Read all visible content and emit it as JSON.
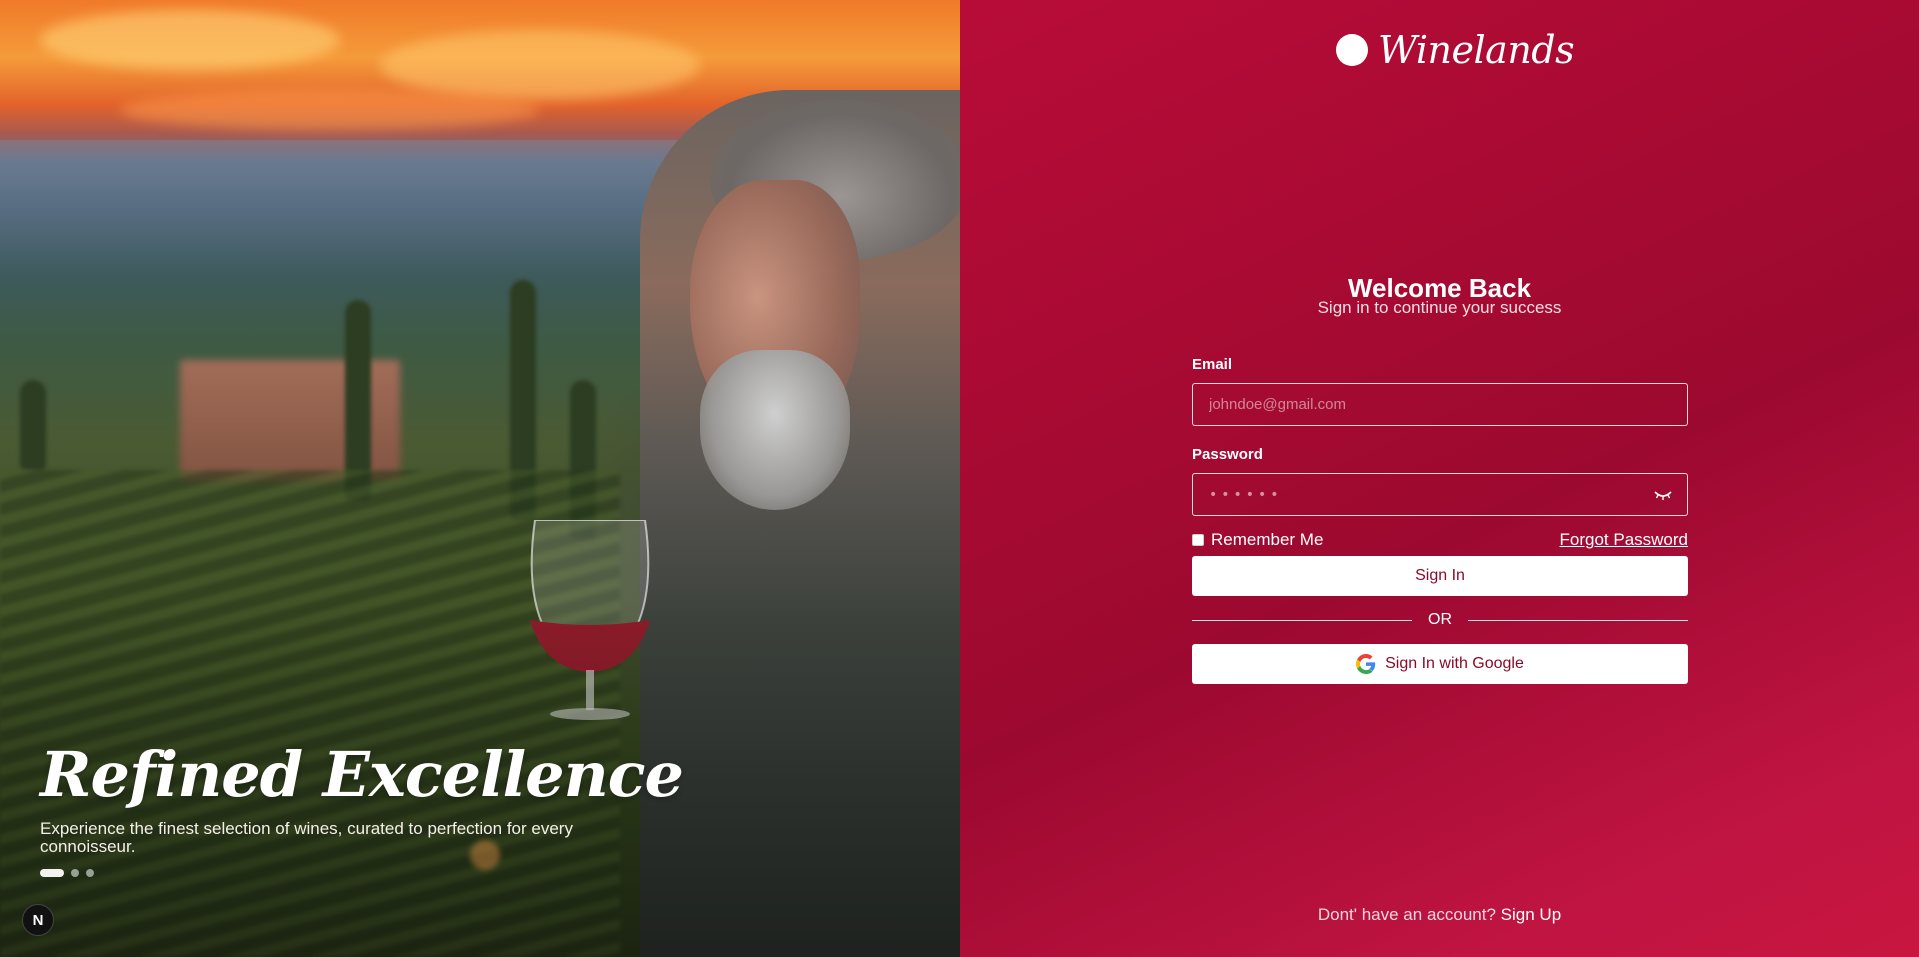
{
  "hero": {
    "title": "Refined Excellence",
    "subtitle": "Experience the finest selection of wines, curated to perfection for every connoisseur.",
    "carousel": {
      "slides": 3,
      "active_index": 0
    },
    "badge": "N"
  },
  "brand": {
    "name": "Winelands"
  },
  "auth": {
    "title": "Welcome Back",
    "subtitle": "Sign in to continue your success",
    "email_label": "Email",
    "email_placeholder": "johndoe@gmail.com",
    "password_label": "Password",
    "password_placeholder": "••••••",
    "remember_label": "Remember Me",
    "forgot_label": "Forgot Password",
    "signin_label": "Sign In",
    "or_label": "OR",
    "google_label": "Sign In with Google",
    "signup_prompt": "Dont' have an account?",
    "signup_label": "Sign Up"
  },
  "colors": {
    "accent": "#a60a32",
    "button_text": "#8a0a2a"
  },
  "icons": {
    "password_toggle": "eye-closed-icon",
    "google": "google-icon"
  }
}
